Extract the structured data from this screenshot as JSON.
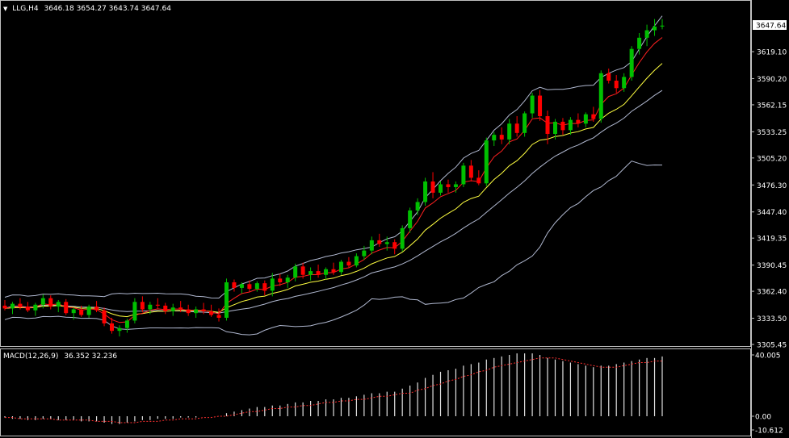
{
  "header": {
    "arrow": "▼",
    "symbol": "LLG,H4",
    "ohlc": "3646.18 3654.27 3643.74 3647.64"
  },
  "macd_header": {
    "label": "MACD(12,26,9)",
    "values": "36.352 32.236"
  },
  "colors": {
    "background": "#000000",
    "frame": "#c0c0c0",
    "bull_candle": "#00c000",
    "bear_candle": "#ff0000",
    "fast_ma": "#ff2020",
    "slow_ma": "#ffff40",
    "bands": "#b0b8d0",
    "macd_hist": "#e0e0e0",
    "macd_signal": "#ff3030",
    "current_price_box": "#ffffff"
  },
  "chart_data": {
    "type": "candlestick",
    "timeframe": "H4",
    "price_axis": {
      "ticks": [
        "3647.64",
        "3619.10",
        "3590.20",
        "3562.15",
        "3533.25",
        "3505.20",
        "3476.30",
        "3447.40",
        "3419.35",
        "3390.45",
        "3362.40",
        "3333.50",
        "3305.45"
      ],
      "current": 3647.64,
      "range": [
        3300.0,
        3665.0
      ]
    },
    "macd_axis": {
      "ticks": [
        "40.005",
        "0.00",
        "-10.612"
      ],
      "range": [
        -10.612,
        40.005
      ]
    },
    "candles": [
      [
        3347,
        3353,
        3342,
        3344
      ],
      [
        3344,
        3351,
        3338,
        3349
      ],
      [
        3349,
        3355,
        3343,
        3346
      ],
      [
        3346,
        3351,
        3340,
        3342
      ],
      [
        3342,
        3350,
        3336,
        3348
      ],
      [
        3348,
        3359,
        3344,
        3355
      ],
      [
        3355,
        3358,
        3343,
        3346
      ],
      [
        3346,
        3353,
        3340,
        3351
      ],
      [
        3351,
        3354,
        3337,
        3339
      ],
      [
        3339,
        3345,
        3332,
        3343
      ],
      [
        3343,
        3347,
        3335,
        3337
      ],
      [
        3337,
        3348,
        3334,
        3346
      ],
      [
        3346,
        3352,
        3340,
        3342
      ],
      [
        3342,
        3345,
        3325,
        3328
      ],
      [
        3328,
        3334,
        3317,
        3320
      ],
      [
        3320,
        3326,
        3314,
        3323
      ],
      [
        3323,
        3333,
        3318,
        3331
      ],
      [
        3331,
        3355,
        3328,
        3351
      ],
      [
        3351,
        3357,
        3340,
        3343
      ],
      [
        3343,
        3351,
        3338,
        3348
      ],
      [
        3348,
        3355,
        3344,
        3347
      ],
      [
        3347,
        3350,
        3338,
        3341
      ],
      [
        3341,
        3349,
        3336,
        3345
      ],
      [
        3345,
        3352,
        3340,
        3343
      ],
      [
        3343,
        3348,
        3336,
        3339
      ],
      [
        3339,
        3346,
        3334,
        3343
      ],
      [
        3343,
        3350,
        3338,
        3341
      ],
      [
        3341,
        3348,
        3335,
        3337
      ],
      [
        3337,
        3344,
        3330,
        3334
      ],
      [
        3334,
        3376,
        3331,
        3372
      ],
      [
        3372,
        3375,
        3362,
        3366
      ],
      [
        3366,
        3372,
        3360,
        3370
      ],
      [
        3370,
        3374,
        3362,
        3365
      ],
      [
        3365,
        3373,
        3362,
        3371
      ],
      [
        3371,
        3374,
        3358,
        3363
      ],
      [
        3363,
        3382,
        3357,
        3376
      ],
      [
        3376,
        3381,
        3368,
        3372
      ],
      [
        3372,
        3380,
        3366,
        3377
      ],
      [
        3377,
        3392,
        3373,
        3389
      ],
      [
        3389,
        3393,
        3376,
        3380
      ],
      [
        3380,
        3388,
        3374,
        3384
      ],
      [
        3384,
        3391,
        3377,
        3380
      ],
      [
        3380,
        3388,
        3375,
        3386
      ],
      [
        3386,
        3393,
        3380,
        3383
      ],
      [
        3383,
        3396,
        3380,
        3394
      ],
      [
        3394,
        3399,
        3388,
        3390
      ],
      [
        3390,
        3403,
        3388,
        3400
      ],
      [
        3400,
        3411,
        3396,
        3406
      ],
      [
        3406,
        3421,
        3402,
        3417
      ],
      [
        3417,
        3424,
        3410,
        3413
      ],
      [
        3413,
        3421,
        3406,
        3415
      ],
      [
        3415,
        3418,
        3402,
        3408
      ],
      [
        3408,
        3433,
        3405,
        3430
      ],
      [
        3430,
        3452,
        3425,
        3449
      ],
      [
        3449,
        3462,
        3444,
        3458
      ],
      [
        3458,
        3484,
        3454,
        3480
      ],
      [
        3480,
        3490,
        3462,
        3468
      ],
      [
        3468,
        3480,
        3465,
        3477
      ],
      [
        3477,
        3482,
        3468,
        3474
      ],
      [
        3474,
        3480,
        3468,
        3477
      ],
      [
        3477,
        3500,
        3474,
        3497
      ],
      [
        3497,
        3503,
        3480,
        3484
      ],
      [
        3484,
        3492,
        3476,
        3478
      ],
      [
        3478,
        3527,
        3475,
        3524
      ],
      [
        3524,
        3533,
        3518,
        3530
      ],
      [
        3530,
        3538,
        3520,
        3525
      ],
      [
        3525,
        3547,
        3520,
        3542
      ],
      [
        3542,
        3550,
        3528,
        3532
      ],
      [
        3532,
        3555,
        3528,
        3553
      ],
      [
        3553,
        3575,
        3548,
        3572
      ],
      [
        3572,
        3578,
        3545,
        3550
      ],
      [
        3550,
        3556,
        3520,
        3531
      ],
      [
        3531,
        3547,
        3525,
        3544
      ],
      [
        3544,
        3548,
        3530,
        3535
      ],
      [
        3535,
        3549,
        3530,
        3546
      ],
      [
        3546,
        3553,
        3538,
        3542
      ],
      [
        3542,
        3554,
        3538,
        3552
      ],
      [
        3552,
        3560,
        3544,
        3547
      ],
      [
        3547,
        3599,
        3543,
        3596
      ],
      [
        3596,
        3601,
        3585,
        3588
      ],
      [
        3588,
        3594,
        3575,
        3580
      ],
      [
        3580,
        3596,
        3576,
        3592
      ],
      [
        3592,
        3625,
        3588,
        3622
      ],
      [
        3622,
        3639,
        3616,
        3634
      ],
      [
        3634,
        3648,
        3625,
        3642
      ],
      [
        3642,
        3654,
        3636,
        3646
      ],
      [
        3646,
        3654,
        3643,
        3647
      ]
    ],
    "macd_hist": [
      -1,
      -2,
      -2,
      -3,
      -3,
      -2,
      -2,
      -3,
      -3,
      -3,
      -4,
      -4,
      -4,
      -5,
      -6,
      -6,
      -5,
      -4,
      -3,
      -3,
      -2,
      -2,
      -2,
      -1,
      -1,
      -1,
      0,
      0,
      0,
      2,
      3,
      4,
      5,
      6,
      6,
      7,
      7,
      8,
      9,
      9,
      10,
      10,
      11,
      11,
      12,
      12,
      13,
      14,
      15,
      15,
      16,
      16,
      18,
      20,
      22,
      25,
      27,
      29,
      30,
      31,
      33,
      34,
      35,
      37,
      38,
      39,
      40,
      41,
      41,
      41,
      40,
      38,
      37,
      36,
      35,
      34,
      33,
      32,
      33,
      33,
      34,
      35,
      36,
      37,
      38,
      38,
      39
    ],
    "macd_signal": [
      -1,
      -1,
      -2,
      -2,
      -2,
      -2,
      -2,
      -3,
      -3,
      -3,
      -3,
      -3,
      -4,
      -4,
      -4,
      -5,
      -5,
      -5,
      -4,
      -4,
      -4,
      -3,
      -3,
      -2,
      -2,
      -2,
      -1,
      -1,
      0,
      0,
      1,
      2,
      3,
      3,
      4,
      5,
      5,
      6,
      6,
      7,
      7,
      8,
      9,
      9,
      10,
      10,
      11,
      11,
      12,
      13,
      13,
      14,
      15,
      15,
      17,
      18,
      20,
      21,
      23,
      24,
      26,
      27,
      29,
      30,
      32,
      33,
      34,
      35,
      36,
      37,
      38,
      38,
      38,
      37,
      36,
      35,
      34,
      33,
      32,
      32,
      32,
      33,
      34,
      35,
      35,
      36,
      36
    ]
  }
}
